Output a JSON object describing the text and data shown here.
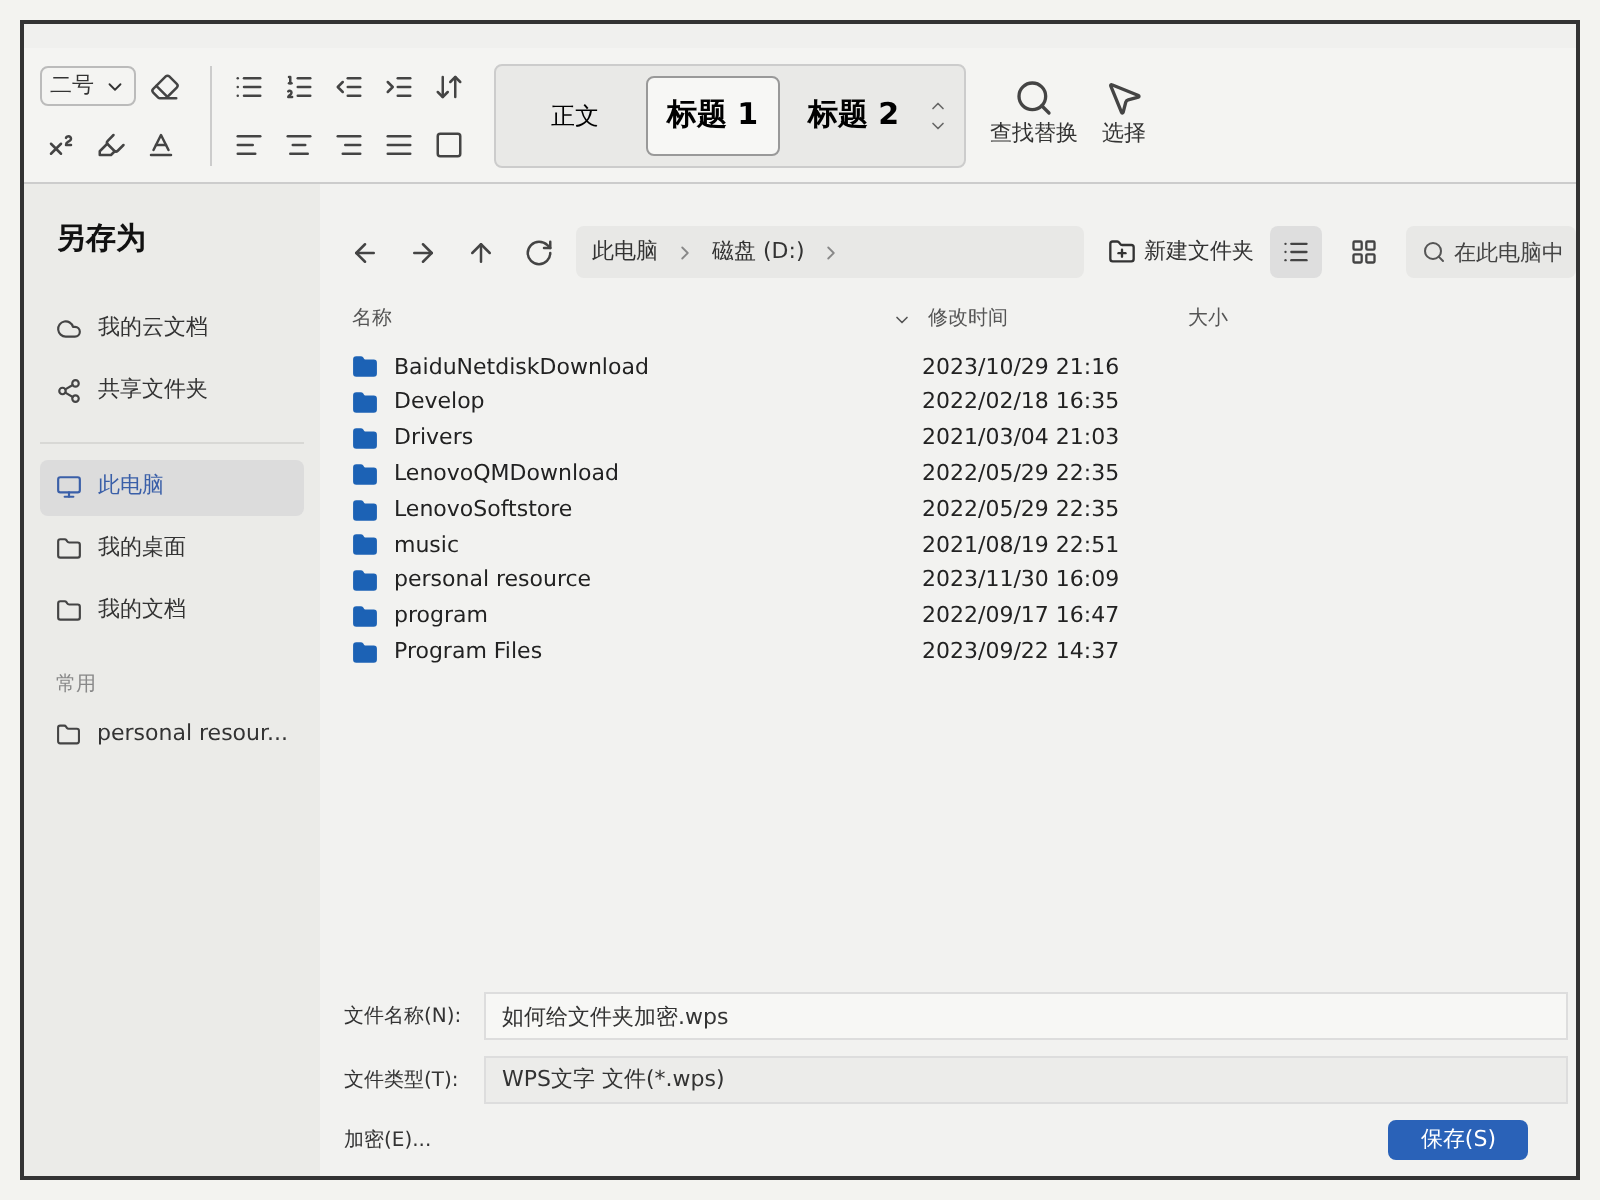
{
  "ribbon": {
    "font_size": "二号",
    "styles": [
      {
        "label": "正文",
        "selected": false
      },
      {
        "label": "标题 1",
        "selected": true
      },
      {
        "label": "标题 2",
        "selected": false
      }
    ],
    "find_replace": "查找替换",
    "select": "选择"
  },
  "dialog": {
    "title": "另存为",
    "sidebar": {
      "items": [
        {
          "label": "我的云文档",
          "kind": "cloud",
          "selected": false
        },
        {
          "label": "共享文件夹",
          "kind": "share",
          "selected": false
        },
        {
          "label": "此电脑",
          "kind": "computer",
          "selected": true
        },
        {
          "label": "我的桌面",
          "kind": "folder",
          "selected": false
        },
        {
          "label": "我的文档",
          "kind": "folder",
          "selected": false
        }
      ],
      "section_label": "常用",
      "recent": [
        {
          "label": "personal resour..."
        }
      ]
    },
    "breadcrumb": [
      "此电脑",
      "磁盘 (D:)"
    ],
    "new_folder": "新建文件夹",
    "views": [
      {
        "kind": "list",
        "selected": true
      },
      {
        "kind": "grid",
        "selected": false
      }
    ],
    "search": {
      "placeholder": "在此电脑中"
    },
    "table": {
      "columns": [
        "名称",
        "修改时间",
        "大小"
      ],
      "rows": [
        {
          "name": "BaiduNetdiskDownload",
          "modified": "2023/10/29 21:16"
        },
        {
          "name": "Develop",
          "modified": "2022/02/18 16:35"
        },
        {
          "name": "Drivers",
          "modified": "2021/03/04 21:03"
        },
        {
          "name": "LenovoQMDownload",
          "modified": "2022/05/29 22:35"
        },
        {
          "name": "LenovoSoftstore",
          "modified": "2022/05/29 22:35"
        },
        {
          "name": "music",
          "modified": "2021/08/19 22:51"
        },
        {
          "name": "personal resource",
          "modified": "2023/11/30 16:09"
        },
        {
          "name": "program",
          "modified": "2022/09/17 16:47"
        },
        {
          "name": "Program Files",
          "modified": "2023/09/22 14:37"
        }
      ]
    },
    "file_name": {
      "label": "文件名称(N):",
      "value": "如何给文件夹加密.wps"
    },
    "file_type": {
      "label": "文件类型(T):",
      "value": "WPS文字 文件(*.wps)"
    },
    "encrypt": "加密(E)...",
    "save": "保存(S)"
  }
}
